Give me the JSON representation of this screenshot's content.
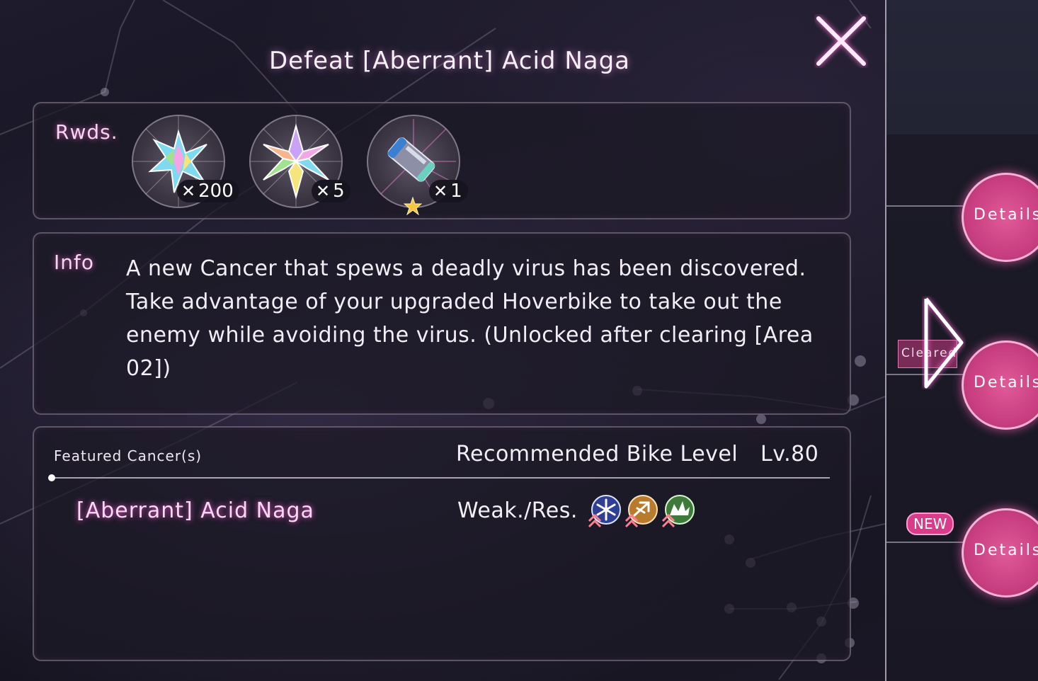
{
  "header": {
    "title": "Defeat [Aberrant] Acid Naga"
  },
  "rewards": {
    "label": "Rwds.",
    "items": [
      {
        "icon": "rainbow-crystal-star-icon",
        "quantity_prefix": "✕",
        "quantity": "200"
      },
      {
        "icon": "rainbow-crystal-flower-icon",
        "quantity_prefix": "✕",
        "quantity": "5"
      },
      {
        "icon": "bike-part-cylinder-icon",
        "quantity_prefix": "✕",
        "quantity": "1",
        "rarity_icon": "star-icon"
      }
    ]
  },
  "info": {
    "label": "Info",
    "text": "A new Cancer that spews a deadly virus has been discovered. Take advantage of your upgraded Hoverbike to take out the enemy while avoiding the virus. (Unlocked after clearing [Area 02])"
  },
  "featured": {
    "label": "Featured Cancer(s)",
    "recommended_label": "Recommended Bike Level",
    "recommended_value": "Lv.80",
    "cancer_name": "[Aberrant] Acid Naga",
    "weak_label": "Weak./Res.",
    "elements": [
      {
        "icon": "ice-element-icon",
        "color": "#2f3f95"
      },
      {
        "icon": "wind-element-icon",
        "color": "#b87a2d"
      },
      {
        "icon": "nature-element-icon",
        "color": "#3e7a3a"
      }
    ]
  },
  "side": {
    "details_label": "Details",
    "cleared_label": "Cleared",
    "new_label": "NEW"
  },
  "colors": {
    "accent_pink": "#d83c8a",
    "glow_pink": "#ff6ad5"
  }
}
